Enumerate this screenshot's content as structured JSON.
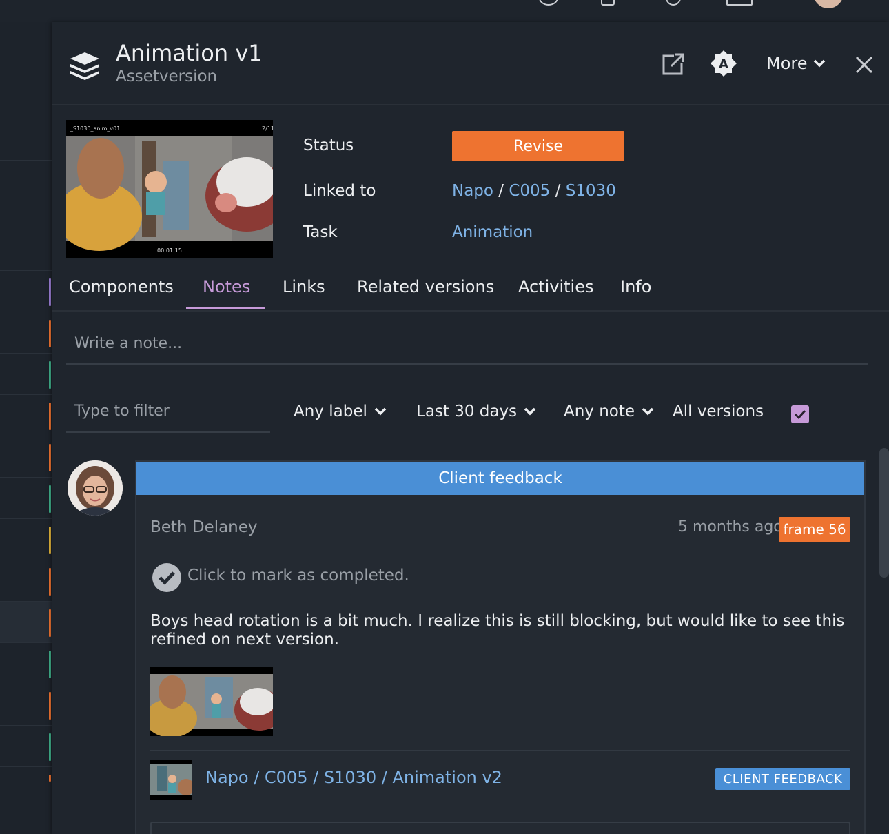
{
  "header": {
    "title": "Animation v1",
    "subtitle": "Assetversion",
    "more_label": "More",
    "icons": [
      "layers-icon",
      "open-external-icon",
      "auto-icon",
      "chevron-down-icon",
      "close-icon"
    ]
  },
  "thumbnail": {
    "overlay_top_left": "_S1030_anim_v01",
    "overlay_top_right": "2/11",
    "overlay_bottom_center": "00:01:15"
  },
  "details": {
    "status_label": "Status",
    "status_value": "Revise",
    "status_color": "#ee7330",
    "linked_label": "Linked to",
    "linked_path": [
      "Napo",
      "C005",
      "S1030"
    ],
    "separator": "/",
    "task_label": "Task",
    "task_value": "Animation"
  },
  "tabs": [
    {
      "label": "Components"
    },
    {
      "label": "Notes",
      "active": true
    },
    {
      "label": "Links"
    },
    {
      "label": "Related versions"
    },
    {
      "label": "Activities"
    },
    {
      "label": "Info"
    }
  ],
  "note_input": {
    "placeholder": "Write a note..."
  },
  "filters": {
    "filter_placeholder": "Type to filter",
    "label_dropdown": "Any label",
    "date_dropdown": "Last 30 days",
    "note_dropdown": "Any note",
    "versions_label": "All versions",
    "all_versions_checked": true
  },
  "note": {
    "category": "Client feedback",
    "category_color": "#4a8fd6",
    "author": "Beth Delaney",
    "time": "5 months ago",
    "frame_badge": "frame 56",
    "complete_text": "Click to mark as completed.",
    "body": "Boys head rotation is a bit much. I realize this is still blocking, but would like to see this refined on next version.",
    "linked_version_path": "Napo / C005 / S1030 / Animation v2",
    "label_badge": "CLIENT FEEDBACK"
  },
  "colors": {
    "accent": "#c69ad8",
    "link": "#7fb3e6",
    "background": "#1f252d"
  }
}
